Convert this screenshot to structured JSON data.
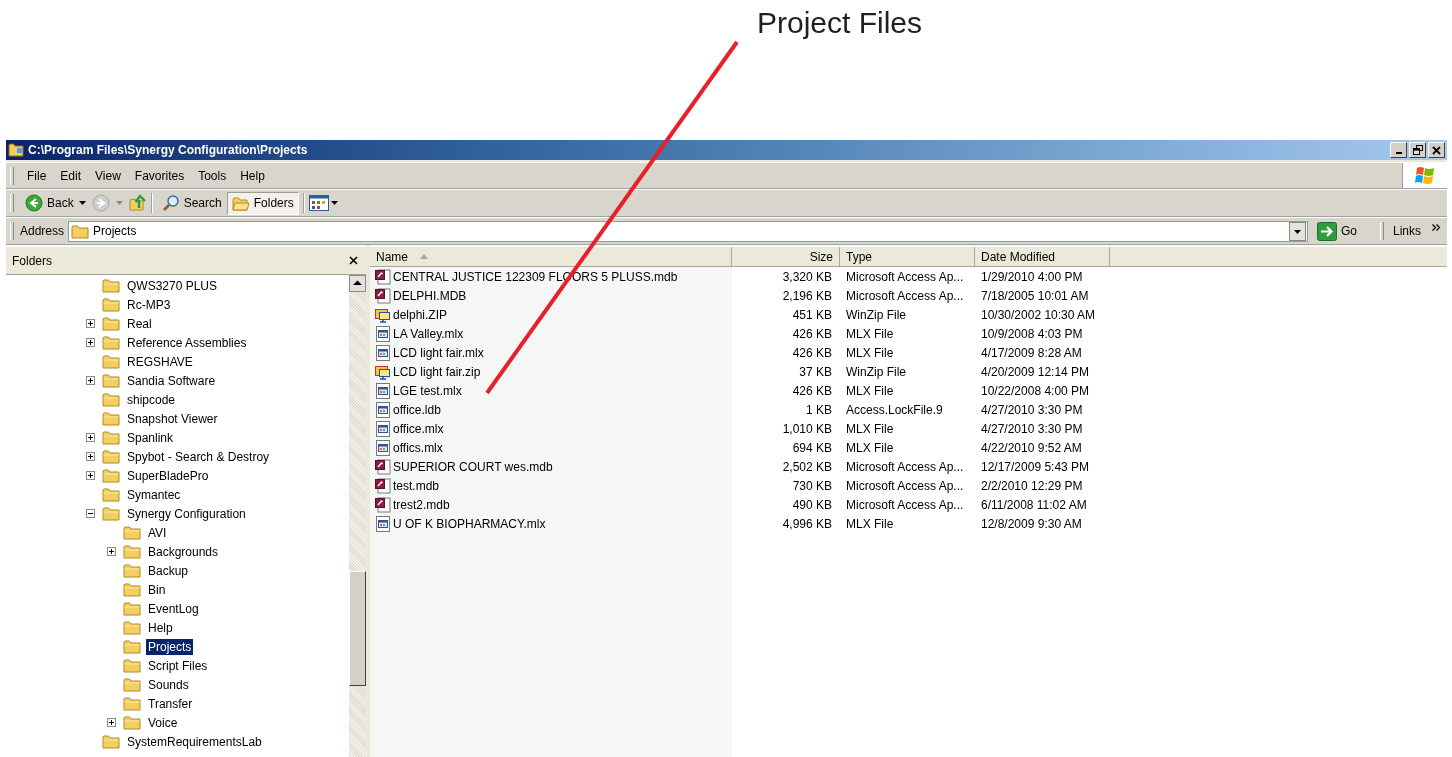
{
  "annotation": {
    "label": "Project Files"
  },
  "window": {
    "title": "C:\\Program Files\\Synergy Configuration\\Projects"
  },
  "menu": [
    "File",
    "Edit",
    "View",
    "Favorites",
    "Tools",
    "Help"
  ],
  "toolbar": {
    "back": "Back",
    "search": "Search",
    "folders": {
      "label": "Folders",
      "pressed": true
    }
  },
  "address": {
    "label": "Address",
    "value": "Projects",
    "go": "Go",
    "links": "Links"
  },
  "folders_pane": {
    "title": "Folders"
  },
  "tree": {
    "items": [
      {
        "name": "QWS3270 PLUS",
        "kind": "leaf",
        "selected": false
      },
      {
        "name": "Rc-MP3",
        "kind": "leaf",
        "selected": false
      },
      {
        "name": "Real",
        "kind": "collapsed",
        "selected": false
      },
      {
        "name": "Reference Assemblies",
        "kind": "collapsed",
        "selected": false
      },
      {
        "name": "REGSHAVE",
        "kind": "leaf",
        "selected": false
      },
      {
        "name": "Sandia Software",
        "kind": "collapsed",
        "selected": false
      },
      {
        "name": "shipcode",
        "kind": "leaf",
        "selected": false
      },
      {
        "name": "Snapshot Viewer",
        "kind": "leaf",
        "selected": false
      },
      {
        "name": "Spanlink",
        "kind": "collapsed",
        "selected": false
      },
      {
        "name": "Spybot - Search & Destroy",
        "kind": "collapsed",
        "selected": false
      },
      {
        "name": "SuperBladePro",
        "kind": "collapsed",
        "selected": false
      },
      {
        "name": "Symantec",
        "kind": "leaf",
        "selected": false
      },
      {
        "name": "Synergy Configuration",
        "kind": "expanded",
        "selected": false,
        "children": [
          {
            "name": "AVI",
            "kind": "leaf",
            "selected": false
          },
          {
            "name": "Backgrounds",
            "kind": "collapsed",
            "selected": false
          },
          {
            "name": "Backup",
            "kind": "leaf",
            "selected": false
          },
          {
            "name": "Bin",
            "kind": "leaf",
            "selected": false
          },
          {
            "name": "EventLog",
            "kind": "leaf",
            "selected": false
          },
          {
            "name": "Help",
            "kind": "leaf",
            "selected": false
          },
          {
            "name": "Projects",
            "kind": "leaf",
            "selected": true
          },
          {
            "name": "Script Files",
            "kind": "leaf",
            "selected": false
          },
          {
            "name": "Sounds",
            "kind": "leaf",
            "selected": false
          },
          {
            "name": "Transfer",
            "kind": "leaf",
            "selected": false
          },
          {
            "name": "Voice",
            "kind": "collapsed",
            "selected": false
          }
        ]
      },
      {
        "name": "SystemRequirementsLab",
        "kind": "leaf",
        "selected": false
      }
    ]
  },
  "file_list": {
    "columns": [
      {
        "label": "Name",
        "sorted": true
      },
      {
        "label": "Size",
        "sorted": false
      },
      {
        "label": "Type",
        "sorted": false
      },
      {
        "label": "Date Modified",
        "sorted": false
      }
    ],
    "rows": [
      {
        "name": "CENTRAL JUSTICE 122309 FLOORS 5 PLUSS.mdb",
        "kind": "access",
        "size": "3,320 KB",
        "type": "Microsoft Access Ap...",
        "date": "1/29/2010 4:00 PM"
      },
      {
        "name": "DELPHI.MDB",
        "kind": "access",
        "size": "2,196 KB",
        "type": "Microsoft Access Ap...",
        "date": "7/18/2005 10:01 AM"
      },
      {
        "name": "delphi.ZIP",
        "kind": "zip",
        "size": "451 KB",
        "type": "WinZip File",
        "date": "10/30/2002 10:30 AM"
      },
      {
        "name": "LA Valley.mlx",
        "kind": "mlx",
        "size": "426 KB",
        "type": "MLX File",
        "date": "10/9/2008 4:03 PM"
      },
      {
        "name": "LCD light fair.mlx",
        "kind": "mlx",
        "size": "426 KB",
        "type": "MLX File",
        "date": "4/17/2009 8:28 AM"
      },
      {
        "name": "LCD light fair.zip",
        "kind": "zip",
        "size": "37 KB",
        "type": "WinZip File",
        "date": "4/20/2009 12:14 PM"
      },
      {
        "name": "LGE test.mlx",
        "kind": "mlx",
        "size": "426 KB",
        "type": "MLX File",
        "date": "10/22/2008 4:00 PM"
      },
      {
        "name": "office.ldb",
        "kind": "mlx",
        "size": "1 KB",
        "type": "Access.LockFile.9",
        "date": "4/27/2010 3:30 PM"
      },
      {
        "name": "office.mlx",
        "kind": "mlx",
        "size": "1,010 KB",
        "type": "MLX File",
        "date": "4/27/2010 3:30 PM"
      },
      {
        "name": "offics.mlx",
        "kind": "mlx",
        "size": "694 KB",
        "type": "MLX File",
        "date": "4/22/2010 9:52 AM"
      },
      {
        "name": "SUPERIOR COURT wes.mdb",
        "kind": "access",
        "size": "2,502 KB",
        "type": "Microsoft Access Ap...",
        "date": "12/17/2009 5:43 PM"
      },
      {
        "name": "test.mdb",
        "kind": "access",
        "size": "730 KB",
        "type": "Microsoft Access Ap...",
        "date": "2/2/2010 12:29 PM"
      },
      {
        "name": "trest2.mdb",
        "kind": "access",
        "size": "490 KB",
        "type": "Microsoft Access Ap...",
        "date": "6/11/2008 11:02 AM"
      },
      {
        "name": "U OF K BIOPHARMACY.mlx",
        "kind": "mlx",
        "size": "4,996 KB",
        "type": "MLX File",
        "date": "12/8/2009 9:30 AM"
      }
    ]
  }
}
